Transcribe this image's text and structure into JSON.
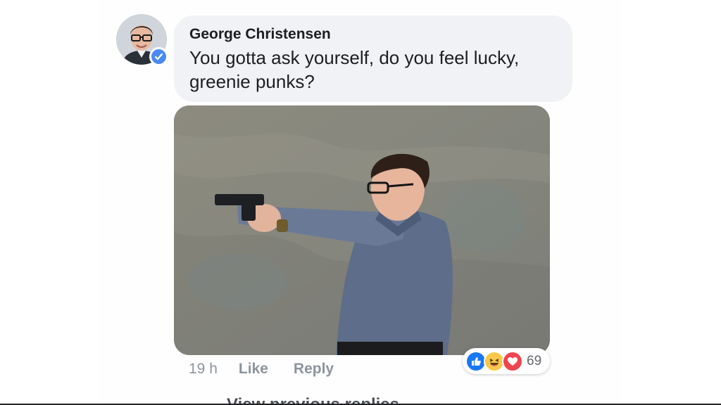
{
  "comment": {
    "author": "George Christensen",
    "text": "You gotta ask yourself, do you feel lucky, greenie punks?",
    "verified": true,
    "accent_color": "#4a8af4"
  },
  "photo": {
    "icon": "photo-of-man-aiming-handgun"
  },
  "actions": {
    "time": "19 h",
    "like_label": "Like",
    "reply_label": "Reply"
  },
  "reactions": {
    "icons": [
      "like-icon",
      "haha-icon",
      "love-icon"
    ],
    "count": "69"
  },
  "footer": {
    "view_more_label": "View previous replies"
  }
}
